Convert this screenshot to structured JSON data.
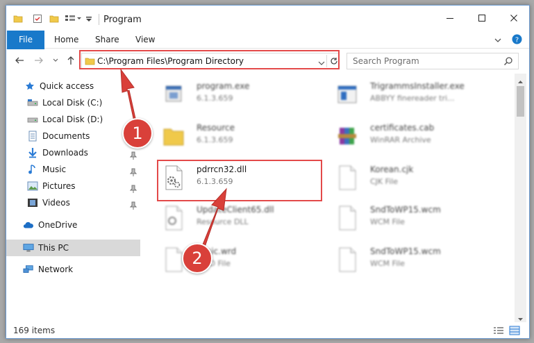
{
  "window": {
    "title": "Program"
  },
  "ribbon": {
    "tabs": [
      "File",
      "Home",
      "Share",
      "View"
    ]
  },
  "nav": {
    "address": "C:\\Program Files\\Program Directory",
    "search_placeholder": "Search Program"
  },
  "sidebar": {
    "items": [
      {
        "label": "Quick access",
        "icon": "star-icon"
      },
      {
        "label": "Local Disk (C:)",
        "icon": "drive-icon"
      },
      {
        "label": "Local Disk (D:)",
        "icon": "drive-icon"
      },
      {
        "label": "Documents",
        "icon": "documents-icon"
      },
      {
        "label": "Downloads",
        "icon": "download-icon"
      },
      {
        "label": "Music",
        "icon": "music-icon"
      },
      {
        "label": "Pictures",
        "icon": "pictures-icon"
      },
      {
        "label": "Videos",
        "icon": "videos-icon"
      },
      {
        "label": "OneDrive",
        "icon": "cloud-icon"
      },
      {
        "label": "This PC",
        "icon": "computer-icon"
      },
      {
        "label": "Network",
        "icon": "network-icon"
      }
    ]
  },
  "files": [
    {
      "name": "program.exe",
      "sub": "6.1.3.659",
      "icon": "exe-icon"
    },
    {
      "name": "TrigrammsInstaller.exe",
      "sub": "ABBYY finereader tri...",
      "icon": "installer-icon"
    },
    {
      "name": "Resource",
      "sub": "6.1.3.659",
      "icon": "folder-icon"
    },
    {
      "name": "certificates.cab",
      "sub": "WinRAR Archive",
      "icon": "archive-icon"
    },
    {
      "name": "pdrrcn32.dll",
      "sub": "6.1.3.659",
      "icon": "dll-icon"
    },
    {
      "name": "Korean.cjk",
      "sub": "CJK File",
      "icon": "file-icon"
    },
    {
      "name": "UpdateClient65.dll",
      "sub": "Resource DLL",
      "icon": "dll-icon"
    },
    {
      "name": "SndToWP15.wcm",
      "sub": "WCM File",
      "icon": "file-icon"
    },
    {
      "name": "basic.wrd",
      "sub": "WRD File",
      "icon": "file-icon"
    },
    {
      "name": "SndToWP15.wcm",
      "sub": "WCM File",
      "icon": "file-icon"
    }
  ],
  "status": {
    "item_count": "169 items"
  },
  "callouts": {
    "step1": "1",
    "step2": "2"
  },
  "colors": {
    "accent": "#1979ca",
    "highlight": "#e34949",
    "badge": "#d9403a"
  }
}
